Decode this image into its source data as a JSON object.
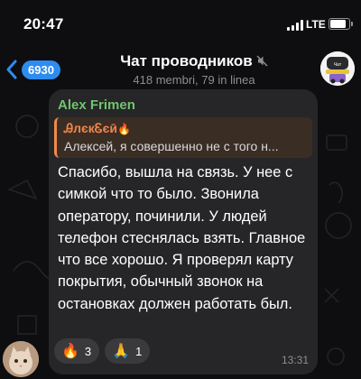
{
  "status_bar": {
    "time": "20:47",
    "network": "LTE"
  },
  "header": {
    "back_badge": "6930",
    "title": "Чат проводников",
    "subtitle": "418 membri, 79 in linea",
    "group_avatar_text": "Чат проводников"
  },
  "message": {
    "sender": "Alex Frimen",
    "reply": {
      "author": "ᎯлєкᏋєӣ",
      "author_emoji": "🔥",
      "text": "Алексей, я совершенно не с того н..."
    },
    "text": "Спасибо, вышла на связь. У нее с симкой что то было. Звонила оператору, починили. У людей телефон стеснялась взять. Главное что все хорошо. Я проверял карту покрытия, обычный звонок на остановках должен работать был.",
    "reactions": [
      {
        "emoji": "🔥",
        "count": "3"
      },
      {
        "emoji": "🙏",
        "count": "1"
      }
    ],
    "time": "13:31"
  },
  "colors": {
    "accent_blue": "#2d8cf0",
    "sender_green": "#70c46e",
    "reply_orange": "#ef8a4a",
    "bubble": "#262628",
    "background": "#0e0e10"
  },
  "icons": [
    "signal-icon",
    "battery-icon",
    "back-chevron-icon",
    "mute-icon"
  ]
}
